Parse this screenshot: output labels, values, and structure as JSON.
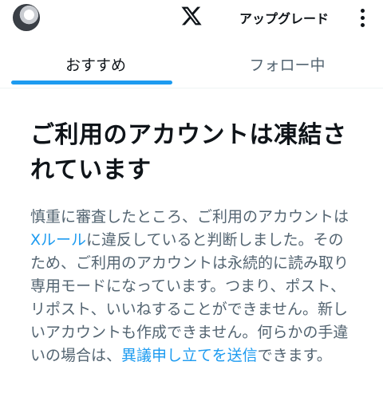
{
  "header": {
    "avatar_icon": "profile-photo",
    "logo_icon": "x-logo-icon",
    "upgrade_label": "アップグレード",
    "more_icon": "more-vertical-icon"
  },
  "tabs": [
    {
      "label": "おすすめ",
      "active": true
    },
    {
      "label": "フォロー中",
      "active": false
    }
  ],
  "notice": {
    "title": "ご利用のアカウントは凍結されています",
    "body_part1": "慎重に審査したところ、ご利用のアカウントは",
    "rules_link": "Xルール",
    "body_part2": "に違反していると判断しました。そのため、ご利用のアカウントは永続的に読み取り専用モードになっています。つまり、ポスト、リポスト、いいねすることができません。新しいアカウントも作成できません。何らかの手違いの場合は、",
    "appeal_link": "異議申し立てを送信",
    "body_part3": "できます。"
  },
  "colors": {
    "accent": "#1d9bf0",
    "text_primary": "#0f1419",
    "text_secondary": "#536471"
  }
}
